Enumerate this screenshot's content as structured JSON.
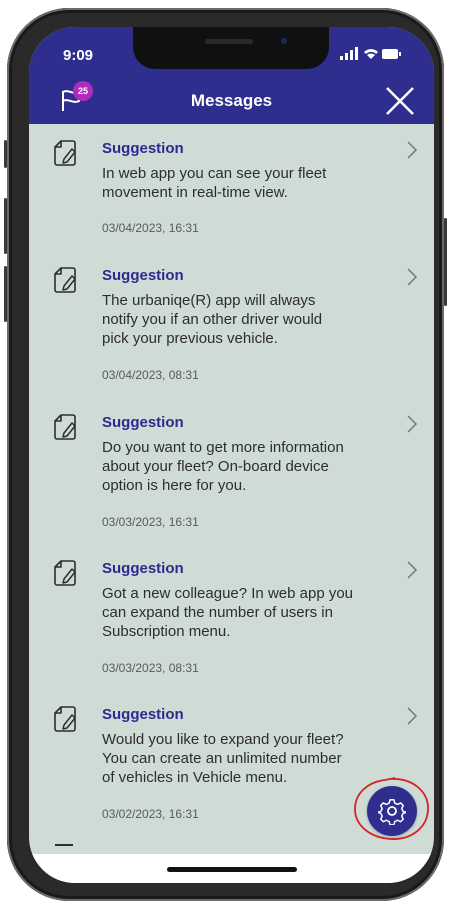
{
  "status_bar": {
    "time": "9:09",
    "icons": "signal wifi battery"
  },
  "header": {
    "title": "Messages",
    "badge_count": "25"
  },
  "messages": [
    {
      "title": "Suggestion",
      "lines": [
        "In web app you can see your fleet",
        "movement in real-time view."
      ],
      "date": "03/04/2023, 16:31"
    },
    {
      "title": "Suggestion",
      "lines": [
        "The urbaniqe(R) app will always",
        "notify you if an other driver would",
        "pick your previous vehicle."
      ],
      "date": "03/04/2023, 08:31"
    },
    {
      "title": "Suggestion",
      "lines": [
        "Do you want to get more information",
        "about your fleet? On-board device",
        "option is here for you."
      ],
      "date": "03/03/2023, 16:31"
    },
    {
      "title": "Suggestion",
      "lines": [
        "Got a new colleague? In web app you",
        "can expand the number of users in",
        "Subscription menu."
      ],
      "date": "03/03/2023, 08:31"
    },
    {
      "title": "Suggestion",
      "lines": [
        "Would you like to expand your fleet?",
        "You can create an unlimited number",
        "of vehicles in Vehicle menu."
      ],
      "date": "03/02/2023, 16:31"
    }
  ],
  "icons": {
    "flag": "flag-icon",
    "close": "close-icon",
    "message": "note-edit-icon",
    "chevron": "chevron-right-icon",
    "settings": "gear-icon"
  },
  "colors": {
    "header": "#2e2e8f",
    "background": "#cfdcd5",
    "accent_title": "#2b2b8f",
    "badge": "#b22bc0",
    "annotation": "#d2232a"
  }
}
